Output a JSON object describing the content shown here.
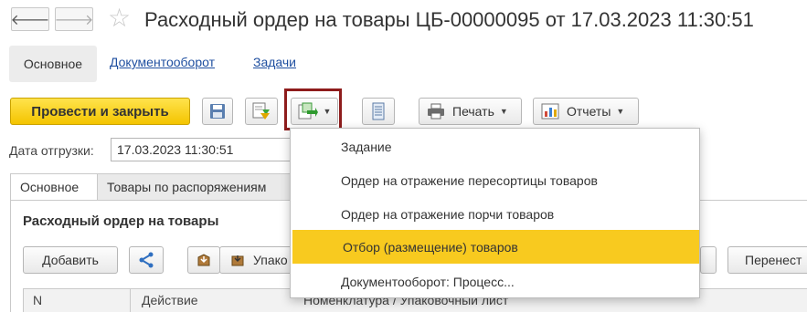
{
  "window": {
    "title": "Расходный ордер на товары ЦБ-00000095 от 17.03.2023 11:30:51"
  },
  "section_tabs": [
    "Основное",
    "Документооборот",
    "Задачи"
  ],
  "toolbar": {
    "post_close": "Провести и закрыть",
    "print": "Печать",
    "reports": "Отчеты"
  },
  "fields": {
    "ship_date_label": "Дата отгрузки:",
    "ship_date_value": "17.03.2023 11:30:51"
  },
  "form_tabs": [
    "Основное",
    "Товары по распоряжениям"
  ],
  "section": {
    "title": "Расходный ордер на товары",
    "add_button": "Добавить",
    "pack_button": "Упако",
    "move_button": "Перенест"
  },
  "grid": {
    "columns": [
      "N",
      "Действие",
      "Номенклатура / Упаковочный лист"
    ]
  },
  "dropdown_menu": {
    "items": [
      "Задание",
      "Ордер на отражение пересортицы товаров",
      "Ордер на отражение порчи товаров",
      "Отбор (размещение) товаров",
      "Документооборот: Процесс..."
    ],
    "highlighted_index": 3,
    "highlight_color": "#f8ca1f"
  },
  "colors": {
    "primary_button": "#f4c400",
    "annotation_frame": "#8e1c1c",
    "link": "#1f4fa0"
  }
}
